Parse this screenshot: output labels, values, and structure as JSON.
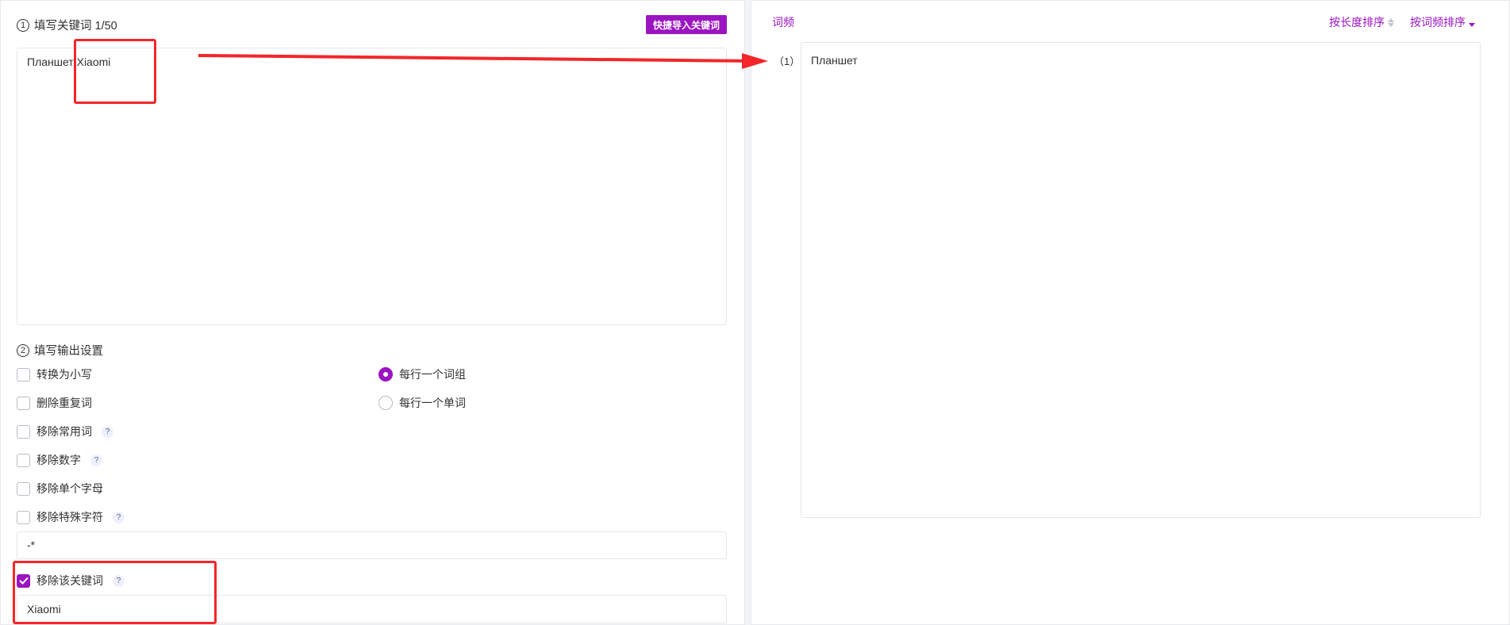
{
  "left": {
    "section1_number": "1",
    "section1_title": "填写关键词 1/50",
    "import_button": "快捷导入关键词",
    "keywords_text": "Планшет Xiaomi",
    "section2_number": "2",
    "section2_title": "填写输出设置",
    "options": {
      "lowercase": "转换为小写",
      "remove_duplicates": "删除重复词",
      "remove_common": "移除常用词",
      "remove_numbers": "移除数字",
      "remove_single_letter": "移除单个字母",
      "remove_special": "移除特殊字符",
      "special_chars_value": "-*",
      "remove_keyword": "移除该关键词",
      "remove_keyword_value": "Xiaomi"
    },
    "radios": {
      "per_line_phrase": "每行一个词组",
      "per_line_word": "每行一个单词"
    },
    "help_glyph": "?"
  },
  "right": {
    "title": "词频",
    "sort_length": "按长度排序",
    "sort_frequency": "按词频排序",
    "result_index": "（1）",
    "result_text": "Планшет"
  },
  "colors": {
    "accent": "#9b14c1",
    "annotation": "#f3262a"
  }
}
